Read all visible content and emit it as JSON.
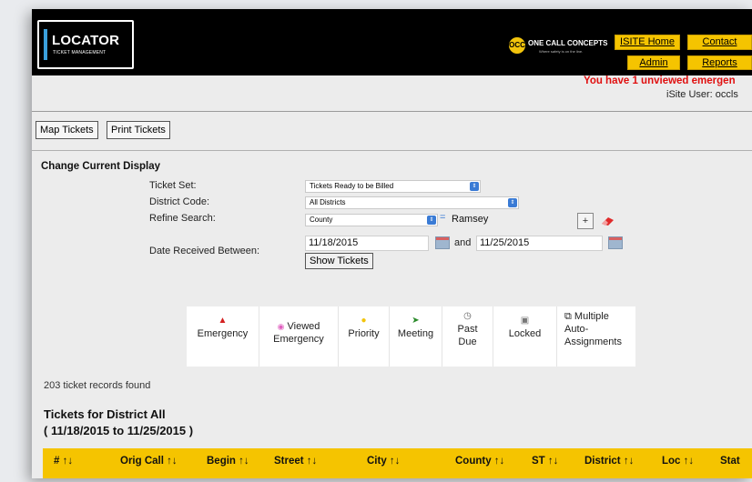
{
  "brand": {
    "logo_title": "LOCATOR",
    "logo_subtitle": "TICKET MANAGEMENT",
    "partner_mark": "OCC",
    "partner_name": "ONE CALL CONCEPTS",
    "partner_tagline": "Where safety is on the line.",
    "accent_color": "#f5c400",
    "stripe_color": "#3aa0dc"
  },
  "nav": {
    "isite_home": "ISITE Home",
    "contact": "Contact",
    "admin": "Admin",
    "reports": "Reports"
  },
  "status": {
    "alert": "You have 1 unviewed emergen",
    "user": "iSite User: occls"
  },
  "toolbar": {
    "map_tickets": "Map Tickets",
    "print_tickets": "Print Tickets"
  },
  "display": {
    "heading": "Change Current Display",
    "ticket_set_label": "Ticket Set:",
    "ticket_set_value": "Tickets Ready to be Billed",
    "district_label": "District Code:",
    "district_value": "All Districts",
    "refine_label": "Refine Search:",
    "refine_field": "County",
    "refine_operator": "=",
    "refine_value": "Ramsey",
    "add_button": "+",
    "date_label": "Date Received Between:",
    "date_from": "11/18/2015",
    "date_and": "and",
    "date_to": "11/25/2015",
    "show_button": "Show Tickets"
  },
  "legend": [
    {
      "icon": "warning-icon",
      "glyph": "▲",
      "color": "#d42020",
      "lines": [
        "",
        "Emergency"
      ]
    },
    {
      "icon": "eye-icon",
      "glyph": "👁",
      "color": "#e060c0",
      "lines": [
        "Viewed",
        "Emergency"
      ],
      "inline_first": true
    },
    {
      "icon": "priority-dot-icon",
      "glyph": "●",
      "color": "#f2c40c",
      "lines": [
        "",
        "Priority"
      ]
    },
    {
      "icon": "meeting-flag-icon",
      "glyph": "➤",
      "color": "#2a8a2a",
      "lines": [
        "",
        "Meeting"
      ]
    },
    {
      "icon": "clock-icon",
      "glyph": "◷",
      "color": "#666666",
      "lines": [
        "Past",
        "Due"
      ]
    },
    {
      "icon": "lock-icon",
      "glyph": "🔒",
      "color": "#777777",
      "lines": [
        "",
        "Locked"
      ]
    },
    {
      "icon": "multi-assign-icon",
      "glyph": "⧉",
      "color": "#333333",
      "lines": [
        "Multiple",
        "Auto-",
        "Assignments"
      ]
    }
  ],
  "results": {
    "count_text": "203 ticket records found",
    "title_line1": "Tickets for District All",
    "title_line2": "( 11/18/2015 to 11/25/2015 )"
  },
  "table": {
    "columns": [
      "# ↑↓",
      "Orig Call ↑↓",
      "Begin ↑↓",
      "Street ↑↓",
      "City ↑↓",
      "County ↑↓",
      "ST ↑↓",
      "District ↑↓",
      "Loc ↑↓",
      "Stat"
    ]
  }
}
